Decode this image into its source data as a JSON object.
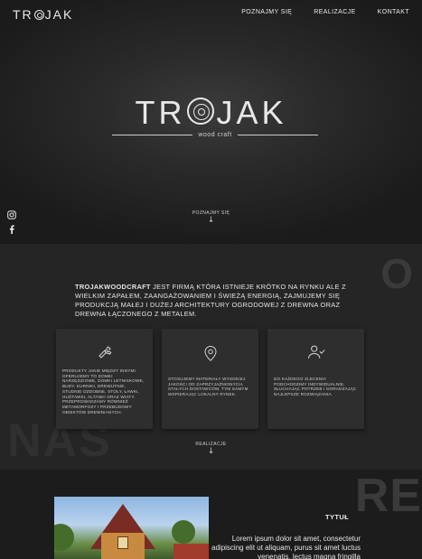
{
  "header": {
    "logo_text": "TROJAK",
    "nav": [
      "POZNAJMY SIĘ",
      "REALIZACJE",
      "KONTAKT"
    ]
  },
  "hero": {
    "logo_left": "TR",
    "logo_right": "JAK",
    "tagline": "wood craft",
    "scroll_label": "POZNAJMY SIĘ",
    "social_icons": [
      "instagram-icon",
      "facebook-icon"
    ]
  },
  "about": {
    "bg_letter": "O",
    "bg_word": "NAS",
    "brand": "TROJAKWOODCRAFT",
    "text": " JEST FIRMĄ KTÓRA ISTNIEJE KRÓTKO NA RYNKU ALE Z WIELKIM ZAPAŁEM, ZAANGAŻOWANIEM I ŚWIEŻĄ ENERGIĄ, ZAJMUJEMY SIĘ PRODUKCJĄ MAŁEJ I DUŻEJ ARCHITEKTURY OGRODOWEJ Z DREWNA ORAZ DREWNA ŁĄCZONEGO Z METALEM.",
    "cards": [
      {
        "icon": "wrench-icon",
        "text": "PRODUKTY JAKIE MIĘDZY INNYMI OFERUJEMY TO DOMKI NARZĘDZIOWE, DOMKI LETNISKOWE, BUDY, KURNIKI, DREWUTNIE, STUDNIE OZDOBNE, STOŁY, ŁAWKI, HUŚTAWKI, ALTANKI ORAZ WIATY. PRZEPROWADZAMY RÓWNIEŻ METAMORFOZY I PRZEBUDOWY OBIEKTÓW DREWNIANYCH."
      },
      {
        "icon": "location-pin-icon",
        "text": "STOSUJEMY MATERIAŁY WYSOKIEJ JAKOŚCI OD ZAPRZYJAŹNIONYCH, STAŁYCH DOSTAWCÓW, TYM SAMYM WSPIERAJĄC LOKALNY RYNEK."
      },
      {
        "icon": "user-check-icon",
        "text": "DO KAŻDEGO ZLECENIA PODCHODZIMY INDYWIDUALNIE, SŁUCHAJĄC POTRZEB I DORADZAJĄC NAJLEPSZE ROZWIĄZANIA."
      }
    ],
    "scroll_label": "REALIZACJE"
  },
  "projects": {
    "bg_word": "RE",
    "title": "TYTUŁ",
    "description": "Lorem ipsum dolor sit amet, consectetur adipiscing elit ut aliquam, purus sit amet luctus venenatis, lectus magna fringilla"
  }
}
